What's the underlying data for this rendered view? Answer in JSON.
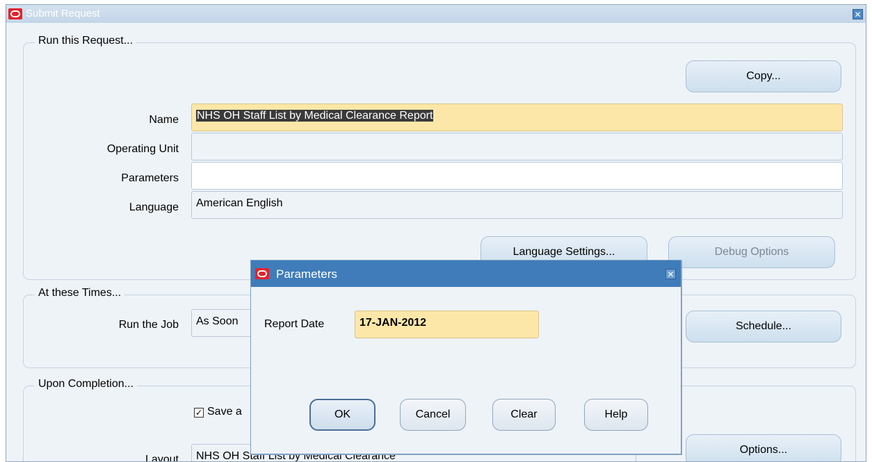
{
  "window": {
    "title": "Submit Request"
  },
  "run_group": {
    "title": "Run this Request...",
    "copy_button": "Copy...",
    "name_label": "Name",
    "name_value": "NHS OH Staff List by Medical Clearance Report",
    "operating_unit_label": "Operating Unit",
    "operating_unit_value": "",
    "parameters_label": "Parameters",
    "parameters_value": "",
    "language_label": "Language",
    "language_value": "American English",
    "language_settings_button": "Language Settings...",
    "debug_options_button": "Debug Options"
  },
  "times_group": {
    "title": "At these Times...",
    "run_job_label": "Run the Job",
    "run_job_value": "As Soon",
    "schedule_button": "Schedule..."
  },
  "completion_group": {
    "title": "Upon Completion...",
    "save_checkbox_label": "Save a",
    "save_checked": true,
    "layout_label": "Layout",
    "layout_value": "NHS OH Staff List by Medical Clearance",
    "options_button": "Options..."
  },
  "dialog": {
    "title": "Parameters",
    "report_date_label": "Report Date",
    "report_date_value": "17-JAN-2012",
    "ok_button": "OK",
    "cancel_button": "Cancel",
    "clear_button": "Clear",
    "help_button": "Help"
  },
  "colors": {
    "required_field": "#fde7a8",
    "dialog_titlebar": "#3f7cb9",
    "oracle_red": "#e3232b"
  },
  "icons": {
    "app_icon": "oracle-logo-icon",
    "close_icon": "close-icon"
  }
}
